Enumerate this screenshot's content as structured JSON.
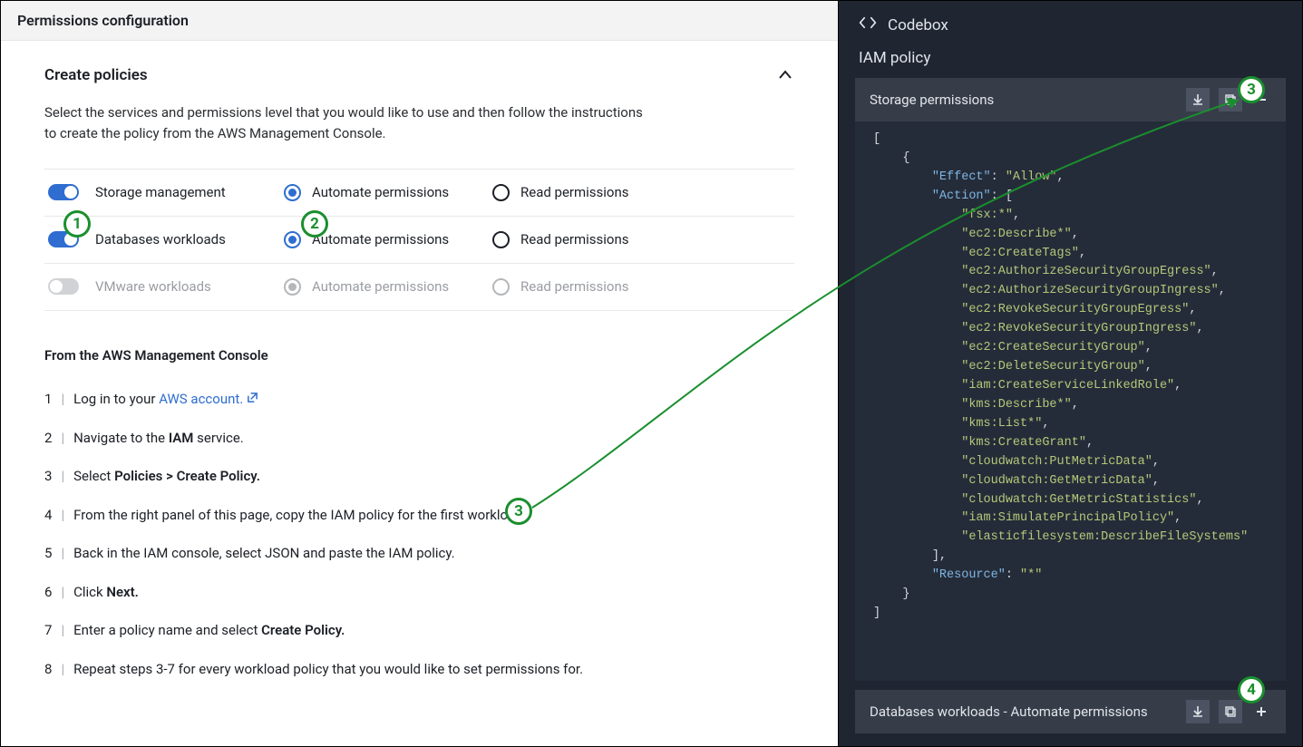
{
  "left": {
    "header": "Permissions configuration",
    "section_title": "Create policies",
    "description_l1": "Select the services and permissions level that you would like to use and then follow the instructions",
    "description_l2": "to create the policy from the AWS Management Console.",
    "workloads": [
      {
        "toggle": true,
        "label": "Storage management",
        "automate": "Automate permissions",
        "read": "Read permissions",
        "disabled": false,
        "auto_selected": true
      },
      {
        "toggle": true,
        "label": "Databases workloads",
        "automate": "Automate permissions",
        "read": "Read permissions",
        "disabled": false,
        "auto_selected": true
      },
      {
        "toggle": false,
        "label": "VMware workloads",
        "automate": "Automate permissions",
        "read": "Read permissions",
        "disabled": true,
        "auto_selected": true
      }
    ],
    "instructions_title": "From the AWS Management Console",
    "steps": {
      "s1a": "Log in to your ",
      "s1b": "AWS account.",
      "s2a": "Navigate to the ",
      "s2b": "IAM",
      "s2c": " service.",
      "s3a": "Select ",
      "s3b": "Policies > Create Policy.",
      "s4": "From the right panel of this page, copy the IAM policy for the first workload.",
      "s5": "Back in the IAM console, select JSON and paste the IAM policy.",
      "s6a": "Click ",
      "s6b": "Next.",
      "s7a": "Enter a policy name and select ",
      "s7b": "Create Policy.",
      "s8": "Repeat steps 3-7 for every workload policy that you would like to set permissions for."
    }
  },
  "right": {
    "codebox_label": "Codebox",
    "iam_title": "IAM policy",
    "snippet1_title": "Storage permissions",
    "snippet2_title": "Databases workloads - Automate permissions",
    "policy": {
      "Effect": "Allow",
      "Resource": "*",
      "Action": [
        "fsx:*",
        "ec2:Describe*",
        "ec2:CreateTags",
        "ec2:AuthorizeSecurityGroupEgress",
        "ec2:AuthorizeSecurityGroupIngress",
        "ec2:RevokeSecurityGroupEgress",
        "ec2:RevokeSecurityGroupIngress",
        "ec2:CreateSecurityGroup",
        "ec2:DeleteSecurityGroup",
        "iam:CreateServiceLinkedRole",
        "kms:Describe*",
        "kms:List*",
        "kms:CreateGrant",
        "cloudwatch:PutMetricData",
        "cloudwatch:GetMetricData",
        "cloudwatch:GetMetricStatistics",
        "iam:SimulatePrincipalPolicy",
        "elasticfilesystem:DescribeFileSystems"
      ]
    }
  },
  "badges": {
    "b1": "1",
    "b2": "2",
    "b3l": "3",
    "b3r": "3",
    "b4": "4"
  }
}
